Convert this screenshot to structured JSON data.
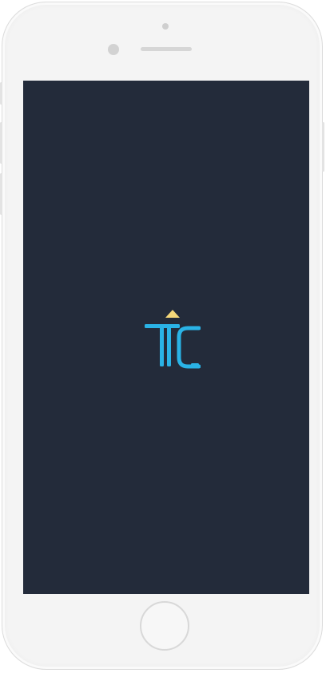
{
  "device": {
    "frame_color": "#f4f4f4",
    "screen_color": "#232b3a"
  },
  "splash": {
    "logo_icon": "tc-logo-icon",
    "logo_letters_color": "#2ab3e6",
    "logo_roof_color": "#f5d87a"
  }
}
